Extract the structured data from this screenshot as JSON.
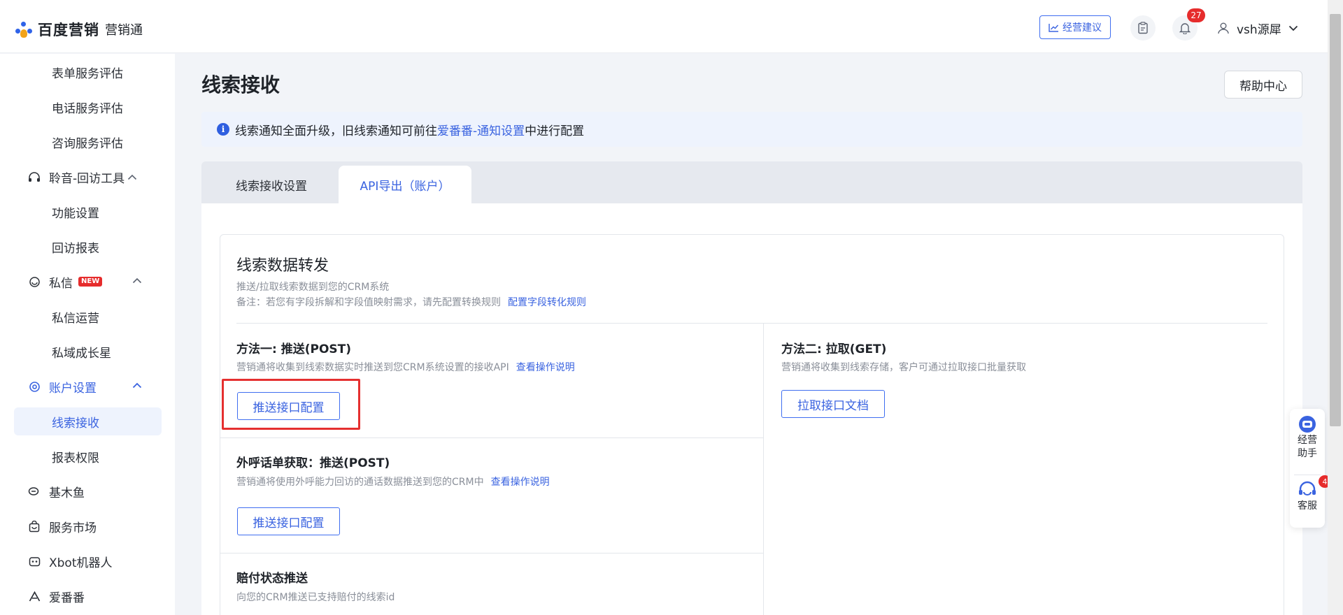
{
  "header": {
    "logo_brand": "百度营销",
    "logo_sub": "营销通",
    "suggest_label": "经营建议",
    "notification_count": "27",
    "username": "vsh源犀"
  },
  "sidebar": {
    "items": [
      {
        "label": "表单服务评估"
      },
      {
        "label": "电话服务评估"
      },
      {
        "label": "咨询服务评估"
      },
      {
        "label": "聆音-回访工具"
      },
      {
        "label": "功能设置"
      },
      {
        "label": "回访报表"
      },
      {
        "label": "私信",
        "tag": "NEW"
      },
      {
        "label": "私信运营"
      },
      {
        "label": "私域成长星"
      },
      {
        "label": "账户设置"
      },
      {
        "label": "线索接收"
      },
      {
        "label": "报表权限"
      },
      {
        "label": "基木鱼"
      },
      {
        "label": "服务市场"
      },
      {
        "label": "Xbot机器人"
      },
      {
        "label": "爱番番"
      }
    ]
  },
  "main": {
    "title": "线索接收",
    "help_label": "帮助中心",
    "notice": {
      "before": "线索通知全面升级，旧线索通知可前往",
      "link": "爱番番-通知设置",
      "after": "中进行配置"
    },
    "tabs": [
      {
        "label": "线索接收设置"
      },
      {
        "label": "API导出（账户）"
      }
    ],
    "card": {
      "title": "线索数据转发",
      "desc1": "推送/拉取线索数据到您的CRM系统",
      "desc2": "备注：若您有字段拆解和字段值映射需求，请先配置转换规则",
      "desc2_link": "配置字段转化规则",
      "method1": {
        "title": "方法一: 推送(POST)",
        "desc": "营销通将收集到线索数据实时推送到您CRM系统设置的接收API",
        "link": "查看操作说明",
        "button": "推送接口配置"
      },
      "method2": {
        "title": "方法二: 拉取(GET)",
        "desc": "营销通将收集到线索存储，客户可通过拉取接口批量获取",
        "button": "拉取接口文档"
      },
      "outbound": {
        "title": "外呼话单获取：推送(POST)",
        "desc": "营销通将使用外呼能力回访的通话数据推送到您的CRM中",
        "link": "查看操作说明",
        "button": "推送接口配置"
      },
      "payment": {
        "title": "赔付状态推送",
        "desc": "向您的CRM推送已支持赔付的线索id"
      }
    }
  },
  "float": {
    "assistant_label_1": "经营",
    "assistant_label_2": "助手",
    "service_label": "客服",
    "service_badge": "4"
  },
  "colors": {
    "accent": "#3a63e0",
    "badge_red": "#e62c2c",
    "highlight_box": "#e53030"
  }
}
